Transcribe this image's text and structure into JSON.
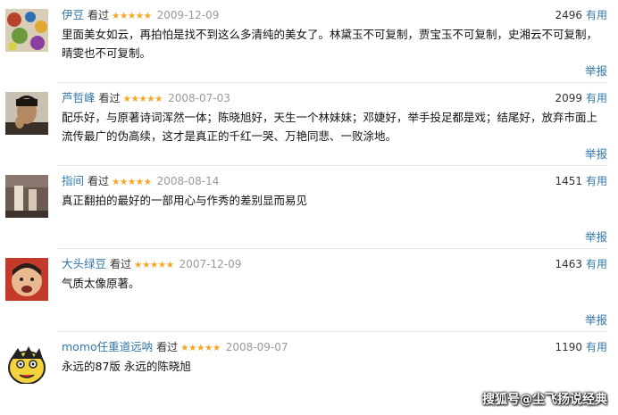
{
  "reviews": [
    {
      "user": "伊豆",
      "status": "看过",
      "stars": "★★★★★",
      "date": "2009-12-09",
      "useful_count": "2496",
      "useful_label": "有用",
      "content": "里面美女如云，再拍怕是找不到这么多清纯的美女了。林黛玉不可复制，贾宝玉不可复制，史湘云不可复制，晴雯也不可复制。",
      "report": "举报"
    },
    {
      "user": "芦哲峰",
      "status": "看过",
      "stars": "★★★★★",
      "date": "2008-07-03",
      "useful_count": "2099",
      "useful_label": "有用",
      "content": "配乐好，与原著诗词浑然一体；陈晓旭好，天生一个林妹妹；邓婕好，举手投足都是戏；结尾好，放弃市面上流传最广的伪高续，这才是真正的千红一哭、万艳同悲、一败涂地。",
      "report": "举报"
    },
    {
      "user": "指间",
      "status": "看过",
      "stars": "★★★★★",
      "date": "2008-08-14",
      "useful_count": "1451",
      "useful_label": "有用",
      "content": "真正翻拍的最好的一部用心与作秀的差别显而易见",
      "report": "举报"
    },
    {
      "user": "大头绿豆",
      "status": "看过",
      "stars": "★★★★★",
      "date": "2007-12-09",
      "useful_count": "1463",
      "useful_label": "有用",
      "content": "气质太像原著。",
      "report": "举报"
    },
    {
      "user": "momo任重道远呐",
      "status": "看过",
      "stars": "★★★★★",
      "date": "2008-09-07",
      "useful_count": "1190",
      "useful_label": "有用",
      "content": "永远的87版 永远的陈晓旭",
      "report": ""
    }
  ],
  "watermark": "搜狐号@尘飞扬说经典",
  "colors": {
    "link": "#3377aa",
    "star": "#f5a623",
    "date": "#999999",
    "divider": "#e6e6e6"
  }
}
